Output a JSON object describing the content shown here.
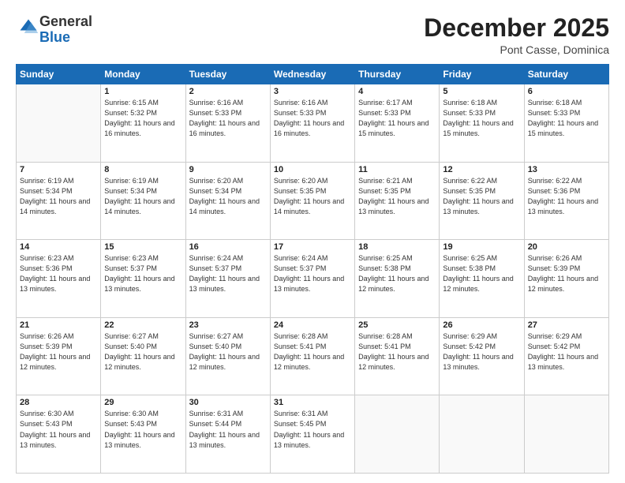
{
  "header": {
    "logo_general": "General",
    "logo_blue": "Blue",
    "month_title": "December 2025",
    "location": "Pont Casse, Dominica"
  },
  "weekdays": [
    "Sunday",
    "Monday",
    "Tuesday",
    "Wednesday",
    "Thursday",
    "Friday",
    "Saturday"
  ],
  "days": [
    {
      "day": "",
      "sunrise": "",
      "sunset": "",
      "daylight": ""
    },
    {
      "day": "1",
      "sunrise": "6:15 AM",
      "sunset": "5:32 PM",
      "daylight": "11 hours and 16 minutes."
    },
    {
      "day": "2",
      "sunrise": "6:16 AM",
      "sunset": "5:33 PM",
      "daylight": "11 hours and 16 minutes."
    },
    {
      "day": "3",
      "sunrise": "6:16 AM",
      "sunset": "5:33 PM",
      "daylight": "11 hours and 16 minutes."
    },
    {
      "day": "4",
      "sunrise": "6:17 AM",
      "sunset": "5:33 PM",
      "daylight": "11 hours and 15 minutes."
    },
    {
      "day": "5",
      "sunrise": "6:18 AM",
      "sunset": "5:33 PM",
      "daylight": "11 hours and 15 minutes."
    },
    {
      "day": "6",
      "sunrise": "6:18 AM",
      "sunset": "5:33 PM",
      "daylight": "11 hours and 15 minutes."
    },
    {
      "day": "7",
      "sunrise": "6:19 AM",
      "sunset": "5:34 PM",
      "daylight": "11 hours and 14 minutes."
    },
    {
      "day": "8",
      "sunrise": "6:19 AM",
      "sunset": "5:34 PM",
      "daylight": "11 hours and 14 minutes."
    },
    {
      "day": "9",
      "sunrise": "6:20 AM",
      "sunset": "5:34 PM",
      "daylight": "11 hours and 14 minutes."
    },
    {
      "day": "10",
      "sunrise": "6:20 AM",
      "sunset": "5:35 PM",
      "daylight": "11 hours and 14 minutes."
    },
    {
      "day": "11",
      "sunrise": "6:21 AM",
      "sunset": "5:35 PM",
      "daylight": "11 hours and 13 minutes."
    },
    {
      "day": "12",
      "sunrise": "6:22 AM",
      "sunset": "5:35 PM",
      "daylight": "11 hours and 13 minutes."
    },
    {
      "day": "13",
      "sunrise": "6:22 AM",
      "sunset": "5:36 PM",
      "daylight": "11 hours and 13 minutes."
    },
    {
      "day": "14",
      "sunrise": "6:23 AM",
      "sunset": "5:36 PM",
      "daylight": "11 hours and 13 minutes."
    },
    {
      "day": "15",
      "sunrise": "6:23 AM",
      "sunset": "5:37 PM",
      "daylight": "11 hours and 13 minutes."
    },
    {
      "day": "16",
      "sunrise": "6:24 AM",
      "sunset": "5:37 PM",
      "daylight": "11 hours and 13 minutes."
    },
    {
      "day": "17",
      "sunrise": "6:24 AM",
      "sunset": "5:37 PM",
      "daylight": "11 hours and 13 minutes."
    },
    {
      "day": "18",
      "sunrise": "6:25 AM",
      "sunset": "5:38 PM",
      "daylight": "11 hours and 12 minutes."
    },
    {
      "day": "19",
      "sunrise": "6:25 AM",
      "sunset": "5:38 PM",
      "daylight": "11 hours and 12 minutes."
    },
    {
      "day": "20",
      "sunrise": "6:26 AM",
      "sunset": "5:39 PM",
      "daylight": "11 hours and 12 minutes."
    },
    {
      "day": "21",
      "sunrise": "6:26 AM",
      "sunset": "5:39 PM",
      "daylight": "11 hours and 12 minutes."
    },
    {
      "day": "22",
      "sunrise": "6:27 AM",
      "sunset": "5:40 PM",
      "daylight": "11 hours and 12 minutes."
    },
    {
      "day": "23",
      "sunrise": "6:27 AM",
      "sunset": "5:40 PM",
      "daylight": "11 hours and 12 minutes."
    },
    {
      "day": "24",
      "sunrise": "6:28 AM",
      "sunset": "5:41 PM",
      "daylight": "11 hours and 12 minutes."
    },
    {
      "day": "25",
      "sunrise": "6:28 AM",
      "sunset": "5:41 PM",
      "daylight": "11 hours and 12 minutes."
    },
    {
      "day": "26",
      "sunrise": "6:29 AM",
      "sunset": "5:42 PM",
      "daylight": "11 hours and 13 minutes."
    },
    {
      "day": "27",
      "sunrise": "6:29 AM",
      "sunset": "5:42 PM",
      "daylight": "11 hours and 13 minutes."
    },
    {
      "day": "28",
      "sunrise": "6:30 AM",
      "sunset": "5:43 PM",
      "daylight": "11 hours and 13 minutes."
    },
    {
      "day": "29",
      "sunrise": "6:30 AM",
      "sunset": "5:43 PM",
      "daylight": "11 hours and 13 minutes."
    },
    {
      "day": "30",
      "sunrise": "6:31 AM",
      "sunset": "5:44 PM",
      "daylight": "11 hours and 13 minutes."
    },
    {
      "day": "31",
      "sunrise": "6:31 AM",
      "sunset": "5:45 PM",
      "daylight": "11 hours and 13 minutes."
    }
  ]
}
